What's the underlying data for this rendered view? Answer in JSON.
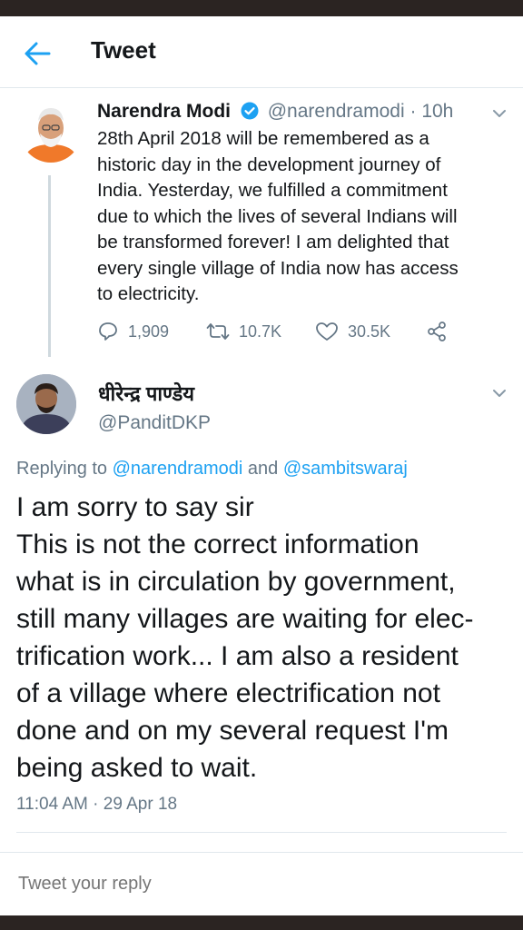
{
  "header": {
    "title": "Tweet",
    "back_icon": "back-arrow-icon"
  },
  "parent_tweet": {
    "author_name": "Narendra Modi",
    "handle": "@narendramodi",
    "time_ago": "10h",
    "separator": "·",
    "text_lines": [
      "28th April 2018 will be remembered as a",
      "historic day in the development journey of",
      "India. Yesterday, we fulfilled a commitment",
      "due to which the lives of several Indians will",
      "be transformed forever! I am delighted that",
      "every single village of India now has access",
      "to electricity."
    ],
    "actions": {
      "replies": "1,909",
      "retweets": "10.7K",
      "likes": "30.5K"
    }
  },
  "reply_tweet": {
    "author_name": "धीरेन्द्र पाण्डेय",
    "handle": "@PanditDKP",
    "replying_prefix": "Replying to ",
    "mention_1": "@narendramodi",
    "replying_and": " and ",
    "mention_2": "@sambitswaraj",
    "text_lines": [
      "I am sorry to say sir",
      "This is not the correct information",
      "what is in circulation by government,",
      "still many villages are waiting for elec-",
      "trification work...  I am also a resident",
      "of a village where electrification not",
      "done and on my several request I'm",
      "being asked to wait."
    ],
    "timestamp": "11:04 AM · 29 Apr 18"
  },
  "compose": {
    "placeholder": "Tweet your reply"
  },
  "colors": {
    "accent": "#1da1f2",
    "muted": "#657786",
    "text": "#14171a"
  }
}
